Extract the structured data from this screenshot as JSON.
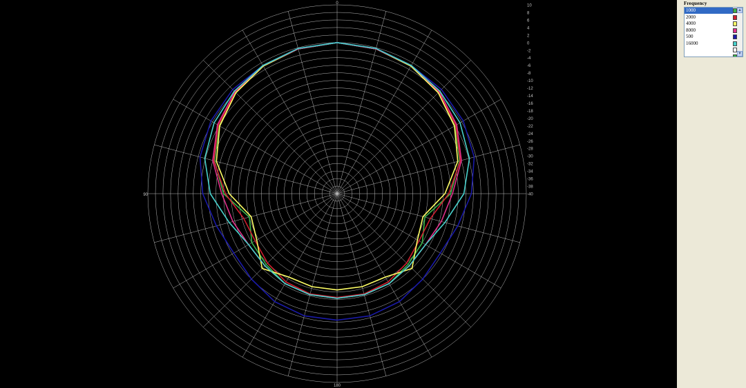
{
  "frequency_panel": {
    "title": "Frequency",
    "items": [
      {
        "label": "1000",
        "color": "#3ab54a",
        "selected": true
      },
      {
        "label": "2000",
        "color": "#d01f2f"
      },
      {
        "label": "4000",
        "color": "#ffff66"
      },
      {
        "label": "8000",
        "color": "#e0308a"
      },
      {
        "label": "500",
        "color": "#1a1aa8"
      },
      {
        "label": "16000",
        "color": "#48d1cc"
      }
    ],
    "extra_swatches": [
      "#ffffff",
      "#3ab54a",
      "#d01f2f",
      "#48d1cc"
    ]
  },
  "chart_data": {
    "type": "polar-line",
    "angle_labels": [
      "0",
      "90",
      "180"
    ],
    "radial_range": [
      -40,
      10
    ],
    "radial_ticks": [
      "10",
      "8",
      "6",
      "4",
      "2",
      "0",
      "-2",
      "-4",
      "-6",
      "-8",
      "-10",
      "-12",
      "-14",
      "-16",
      "-18",
      "-20",
      "-22",
      "-24",
      "-26",
      "-28",
      "-30",
      "-32",
      "-34",
      "-36",
      "-38",
      "-40"
    ],
    "grid": true,
    "angles_deg": [
      0,
      15,
      30,
      45,
      60,
      75,
      90,
      105,
      120,
      135,
      150,
      165,
      180
    ],
    "series": [
      {
        "name": "1000",
        "color": "#3ab54a",
        "values": [
          0.0,
          -0.3,
          -1.0,
          -2.2,
          -4.0,
          -6.5,
          -10.0,
          -16.0,
          -14.0,
          -13.5,
          -12.5,
          -12.3,
          -12.3
        ]
      },
      {
        "name": "2000",
        "color": "#d01f2f",
        "values": [
          0.0,
          -0.3,
          -1.0,
          -2.0,
          -3.8,
          -6.3,
          -10.5,
          -14.5,
          -15.0,
          -14.0,
          -13.0,
          -12.5,
          -12.5
        ]
      },
      {
        "name": "4000",
        "color": "#ffff66",
        "values": [
          0.0,
          -0.3,
          -1.0,
          -2.2,
          -4.2,
          -7.0,
          -11.5,
          -16.5,
          -15.5,
          -12.0,
          -14.5,
          -14.5,
          -14.5
        ]
      },
      {
        "name": "8000",
        "color": "#e0308a",
        "values": [
          0.0,
          -0.3,
          -0.8,
          -1.8,
          -3.5,
          -6.0,
          -9.5,
          -11.5,
          -13.0,
          -13.0,
          -12.5,
          -12.3,
          -12.3
        ]
      },
      {
        "name": "500",
        "color": "#1a1aa8",
        "values": [
          0.0,
          -0.2,
          -0.8,
          -1.0,
          -1.5,
          -2.5,
          -4.5,
          -7.0,
          -8.5,
          -8.0,
          -7.0,
          -6.5,
          -6.5
        ]
      },
      {
        "name": "16000",
        "color": "#48d1cc",
        "values": [
          0.0,
          -0.2,
          -0.8,
          -1.6,
          -2.5,
          -3.8,
          -6.5,
          -10.5,
          -13.0,
          -13.0,
          -12.5,
          -12.3,
          -12.3
        ]
      }
    ]
  }
}
